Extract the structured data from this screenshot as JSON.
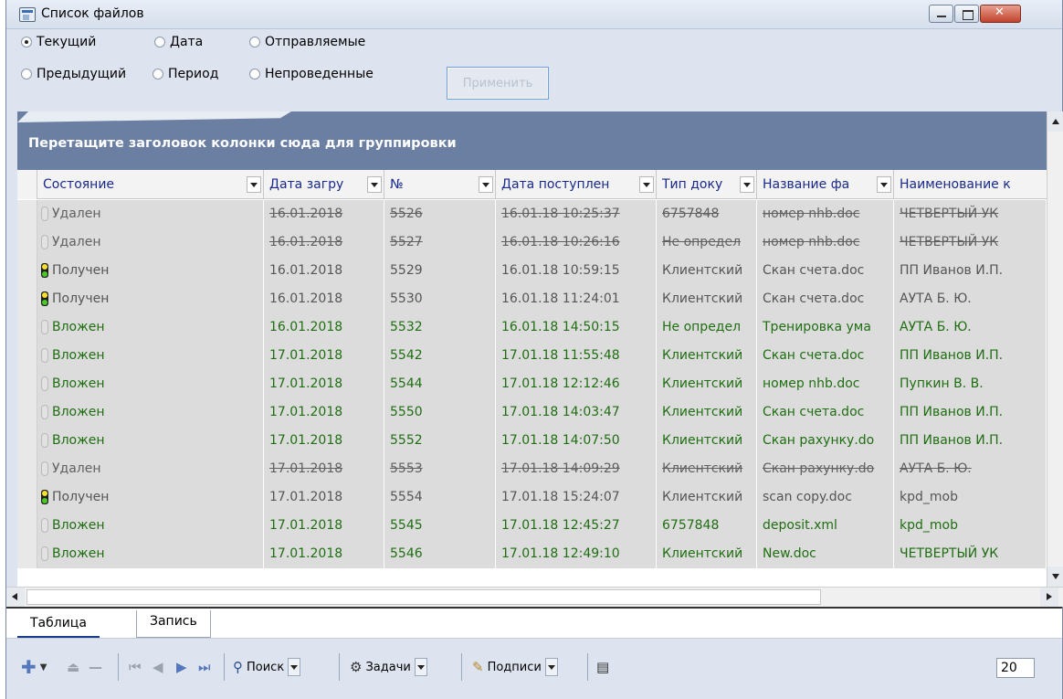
{
  "window": {
    "title": "Список файлов",
    "controls": [
      "minimize",
      "maximize",
      "close"
    ]
  },
  "filters": {
    "options": [
      {
        "label": "Текущий",
        "checked": true
      },
      {
        "label": "Дата",
        "checked": false
      },
      {
        "label": "Отправляемые",
        "checked": false
      },
      {
        "label": "Предыдущий",
        "checked": false
      },
      {
        "label": "Период",
        "checked": false
      },
      {
        "label": "Непроведенные",
        "checked": false
      }
    ],
    "apply_label": "Применить"
  },
  "grid": {
    "group_hint": "Перетащите заголовок колонки сюда для группировки",
    "columns": [
      "Состояние",
      "Дата загру",
      "№",
      "Дата поступлен",
      "Тип доку",
      "Название фа",
      "Наименование к"
    ],
    "rows": [
      {
        "status": "Удален",
        "kind": "deleted",
        "light": "off",
        "date": "16.01.2018",
        "num": "5526",
        "received": "16.01.18 10:25:37",
        "type": "6757848",
        "file": "номер nhb.doc",
        "name": "ЧЕТВЕРТЫЙ УК"
      },
      {
        "status": "Удален",
        "kind": "deleted",
        "light": "off",
        "date": "16.01.2018",
        "num": "5527",
        "received": "16.01.18 10:26:16",
        "type": "Не определ",
        "file": "номер nhb.doc",
        "name": "ЧЕТВЕРТЫЙ УК"
      },
      {
        "status": "Получен",
        "kind": "received",
        "light": "on",
        "date": "16.01.2018",
        "num": "5529",
        "received": "16.01.18 10:59:15",
        "type": "Клиентский",
        "file": "Скан счета.doc",
        "name": "ПП Иванов И.П."
      },
      {
        "status": "Получен",
        "kind": "received",
        "light": "on",
        "date": "16.01.2018",
        "num": "5530",
        "received": "16.01.18 11:24:01",
        "type": "Клиентский",
        "file": "Скан счета.doc",
        "name": "АУТА Б. Ю."
      },
      {
        "status": "Вложен",
        "kind": "attached",
        "light": "off",
        "date": "16.01.2018",
        "num": "5532",
        "received": "16.01.18 14:50:15",
        "type": "Не определ",
        "file": "Тренировка ума",
        "name": "АУТА Б. Ю."
      },
      {
        "status": "Вложен",
        "kind": "attached",
        "light": "off",
        "date": "17.01.2018",
        "num": "5542",
        "received": "17.01.18 11:55:48",
        "type": "Клиентский",
        "file": "Скан счета.doc",
        "name": "ПП Иванов И.П."
      },
      {
        "status": "Вложен",
        "kind": "attached",
        "light": "off",
        "date": "17.01.2018",
        "num": "5544",
        "received": "17.01.18 12:12:46",
        "type": "Клиентский",
        "file": "номер nhb.doc",
        "name": "Пупкин В. В."
      },
      {
        "status": "Вложен",
        "kind": "attached",
        "light": "off",
        "date": "17.01.2018",
        "num": "5550",
        "received": "17.01.18 14:03:47",
        "type": "Клиентский",
        "file": "Скан счета.doc",
        "name": "ПП Иванов И.П."
      },
      {
        "status": "Вложен",
        "kind": "attached",
        "light": "off",
        "date": "17.01.2018",
        "num": "5552",
        "received": "17.01.18 14:07:50",
        "type": "Клиентский",
        "file": "Скан рахунку.do",
        "name": "ПП Иванов И.П."
      },
      {
        "status": "Удален",
        "kind": "deleted",
        "light": "off",
        "date": "17.01.2018",
        "num": "5553",
        "received": "17.01.18 14:09:29",
        "type": "Клиентский",
        "file": "Скан рахунку.do",
        "name": "АУТА Б. Ю."
      },
      {
        "status": "Получен",
        "kind": "received",
        "light": "on",
        "date": "17.01.2018",
        "num": "5554",
        "received": "17.01.18 15:24:07",
        "type": "Клиентский",
        "file": "scan copy.doc",
        "name": "kpd_mob"
      },
      {
        "status": "Вложен",
        "kind": "attached",
        "light": "off",
        "date": "17.01.2018",
        "num": "5545",
        "received": "17.01.18 12:45:27",
        "type": "6757848",
        "file": "deposit.xml",
        "name": "kpd_mob"
      },
      {
        "status": "Вложен",
        "kind": "attached",
        "light": "off",
        "date": "17.01.2018",
        "num": "5546",
        "received": "17.01.18 12:49:10",
        "type": "Клиентский",
        "file": "New.doc",
        "name": "ЧЕТВЕРТЫЙ УК"
      }
    ]
  },
  "tabs": [
    {
      "label": "Таблица",
      "active": true
    },
    {
      "label": "Запись",
      "active": false
    }
  ],
  "toolbar": {
    "search_label": "Поиск",
    "tasks_label": "Задачи",
    "signatures_label": "Подписи",
    "page_size": "20"
  },
  "colors": {
    "group_panel": "#6b7fa3",
    "attached_text": "#1f6e12",
    "header_text": "#1a2a8a"
  }
}
